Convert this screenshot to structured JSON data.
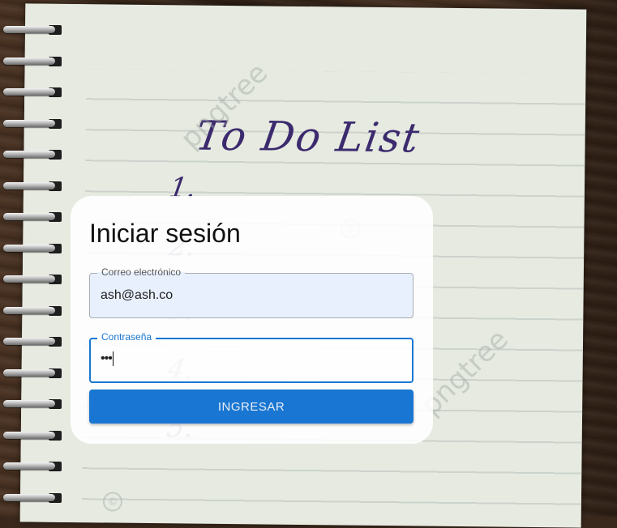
{
  "background": {
    "handwriting_title": "To Do List",
    "numbers": [
      "1.",
      "2.",
      "3.",
      "4.",
      "5."
    ],
    "watermark_text": "pngtree",
    "copyright_symbol": "©"
  },
  "login": {
    "title": "Iniciar sesión",
    "email": {
      "label": "Correo electrónico",
      "value": "ash@ash.co"
    },
    "password": {
      "label": "Contraseña",
      "masked_value": "•••"
    },
    "submit_label": "INGRESAR"
  },
  "colors": {
    "accent": "#1976d2",
    "email_fill": "#e8f0fe"
  }
}
